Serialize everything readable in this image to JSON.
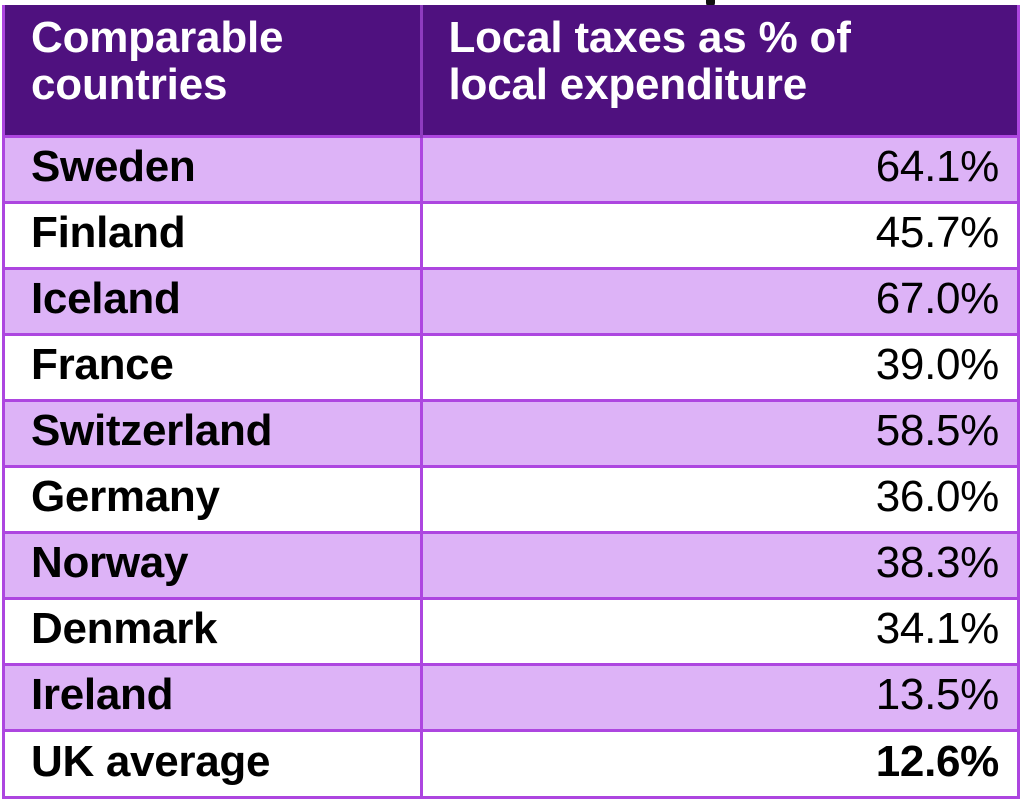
{
  "table": {
    "columns": [
      {
        "key": "country",
        "label": "Comparable countries",
        "align": "left"
      },
      {
        "key": "value",
        "label": "Local taxes as % of local expenditure",
        "align": "right"
      }
    ],
    "header": {
      "country_label_line1": "Comparable",
      "country_label_line2": "countries",
      "value_label_line1": "Local taxes as % of",
      "value_label_line2": "local expenditure"
    },
    "rows": [
      {
        "country": "Sweden",
        "value": "64.1%",
        "shaded": true,
        "emphasis": false
      },
      {
        "country": "Finland",
        "value": "45.7%",
        "shaded": false,
        "emphasis": false
      },
      {
        "country": "Iceland",
        "value": "67.0%",
        "shaded": true,
        "emphasis": false
      },
      {
        "country": "France",
        "value": "39.0%",
        "shaded": false,
        "emphasis": false
      },
      {
        "country": "Switzerland",
        "value": "58.5%",
        "shaded": true,
        "emphasis": false
      },
      {
        "country": "Germany",
        "value": "36.0%",
        "shaded": false,
        "emphasis": false
      },
      {
        "country": "Norway",
        "value": "38.3%",
        "shaded": true,
        "emphasis": false
      },
      {
        "country": "Denmark",
        "value": "34.1%",
        "shaded": false,
        "emphasis": false
      },
      {
        "country": "Ireland",
        "value": "13.5%",
        "shaded": true,
        "emphasis": false
      },
      {
        "country": "UK average",
        "value": "12.6%",
        "shaded": false,
        "emphasis": true
      }
    ]
  },
  "chart_data": {
    "type": "table",
    "title": "",
    "categories": [
      "Sweden",
      "Finland",
      "Iceland",
      "France",
      "Switzerland",
      "Germany",
      "Norway",
      "Denmark",
      "Ireland",
      "UK average"
    ],
    "values": [
      64.1,
      45.7,
      67.0,
      39.0,
      58.5,
      36.0,
      38.3,
      34.1,
      13.5,
      12.6
    ],
    "xlabel": "Comparable countries",
    "ylabel": "Local taxes as % of local expenditure",
    "unit": "%",
    "highlighted": [
      "UK average"
    ]
  },
  "colors": {
    "header_background": "#4F117F",
    "header_text": "#FFFFFF",
    "row_shaded": "#DDB3F7",
    "row_plain": "#FFFFFF",
    "gridline": "#AD46E0",
    "body_text": "#000000"
  }
}
